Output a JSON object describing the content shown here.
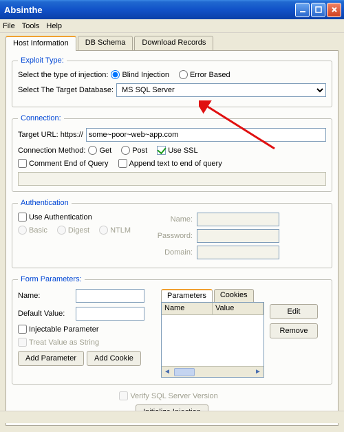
{
  "title": "Absinthe",
  "menu": {
    "file": "File",
    "tools": "Tools",
    "help": "Help"
  },
  "tabs": {
    "host": "Host Information",
    "db": "DB Schema",
    "dl": "Download Records"
  },
  "exploit": {
    "legend": "Exploit Type:",
    "select_type": "Select the type of injection:",
    "blind": "Blind Injection",
    "error": "Error Based",
    "select_db": "Select The Target Database:",
    "db_value": "MS SQL Server"
  },
  "conn": {
    "legend": "Connection:",
    "url_label": "Target URL: https://",
    "url_value": "some~poor~web~app.com",
    "method_label": "Connection Method:",
    "get": "Get",
    "post": "Post",
    "ssl": "Use SSL",
    "comment_eoq": "Comment End of Query",
    "append": "Append text to end of query"
  },
  "auth": {
    "legend": "Authentication",
    "use": "Use Authentication",
    "basic": "Basic",
    "digest": "Digest",
    "ntlm": "NTLM",
    "name": "Name:",
    "password": "Password:",
    "domain": "Domain:"
  },
  "fp": {
    "legend": "Form Parameters:",
    "name": "Name:",
    "default": "Default Value:",
    "inject": "Injectable Parameter",
    "treat": "Treat Value as String",
    "add_param": "Add Parameter",
    "add_cookie": "Add Cookie",
    "tab_params": "Parameters",
    "tab_cookies": "Cookies",
    "col_name": "Name",
    "col_value": "Value",
    "edit": "Edit",
    "remove": "Remove"
  },
  "bottom": {
    "verify": "Verify SQL Server Version",
    "init": "Initialize Injection"
  }
}
